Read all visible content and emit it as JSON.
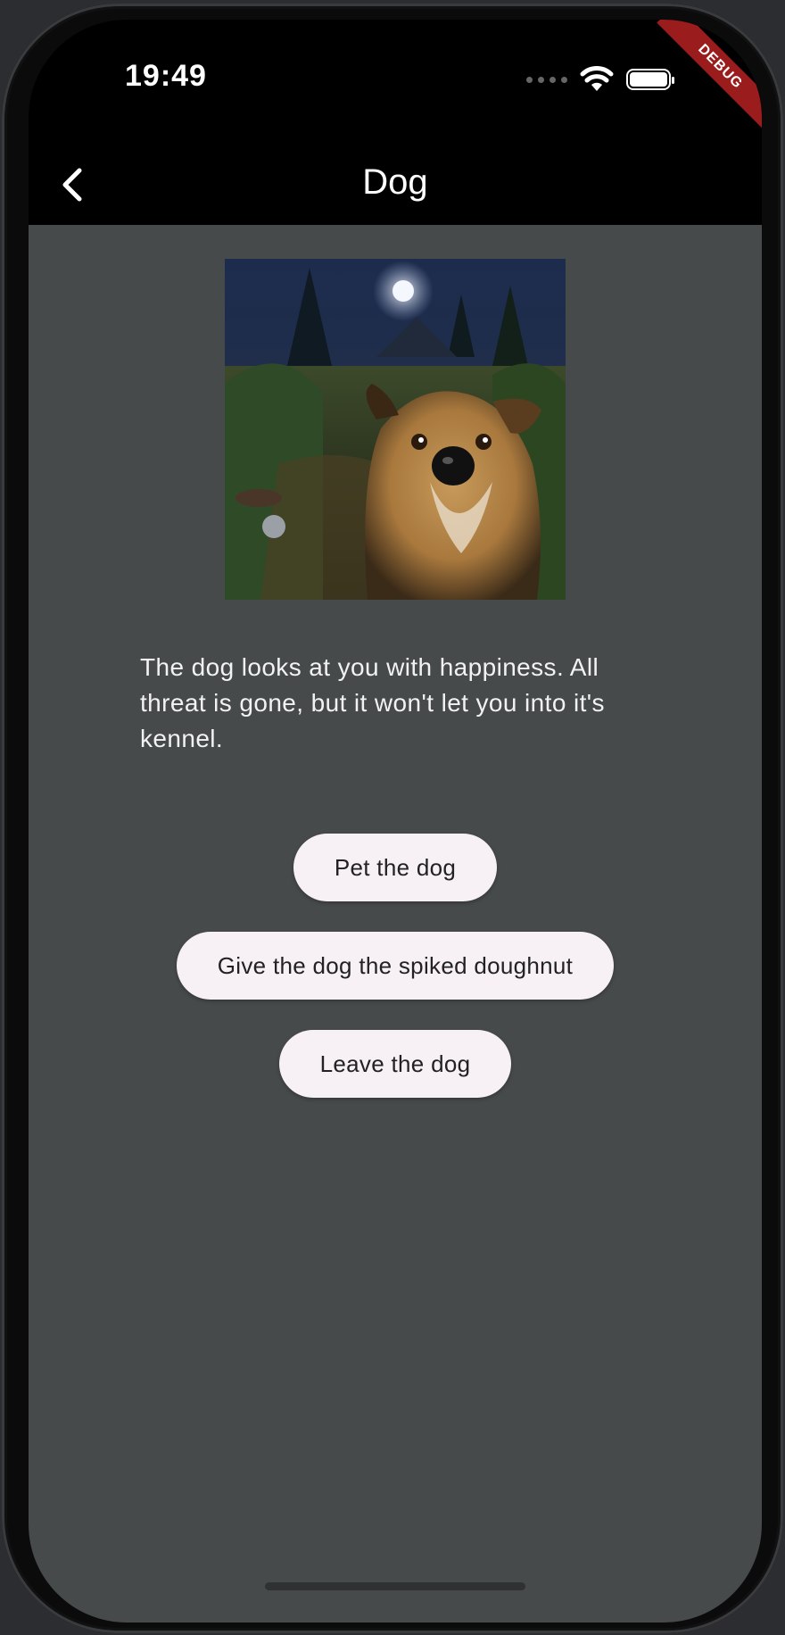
{
  "status_bar": {
    "time": "19:49",
    "signal_icon": "cellular-dots-icon",
    "wifi_icon": "wifi-icon",
    "battery_icon": "battery-icon",
    "battery_level": 1.0
  },
  "debug_banner": "DEBUG",
  "app_bar": {
    "title": "Dog",
    "back_icon": "chevron-left-icon"
  },
  "scene": {
    "image_icon": "dog-in-moonlit-garden-illustration",
    "text": "The dog looks at you with happiness. All threat is gone, but it won't let you into it's kennel."
  },
  "choices": [
    {
      "label": "Pet the dog"
    },
    {
      "label": "Give the dog the spiked doughnut"
    },
    {
      "label": "Leave the dog"
    }
  ],
  "colors": {
    "content_background": "#474a4a",
    "button_background": "#f7f1f5",
    "debug_banner": "#9b1c1c"
  }
}
